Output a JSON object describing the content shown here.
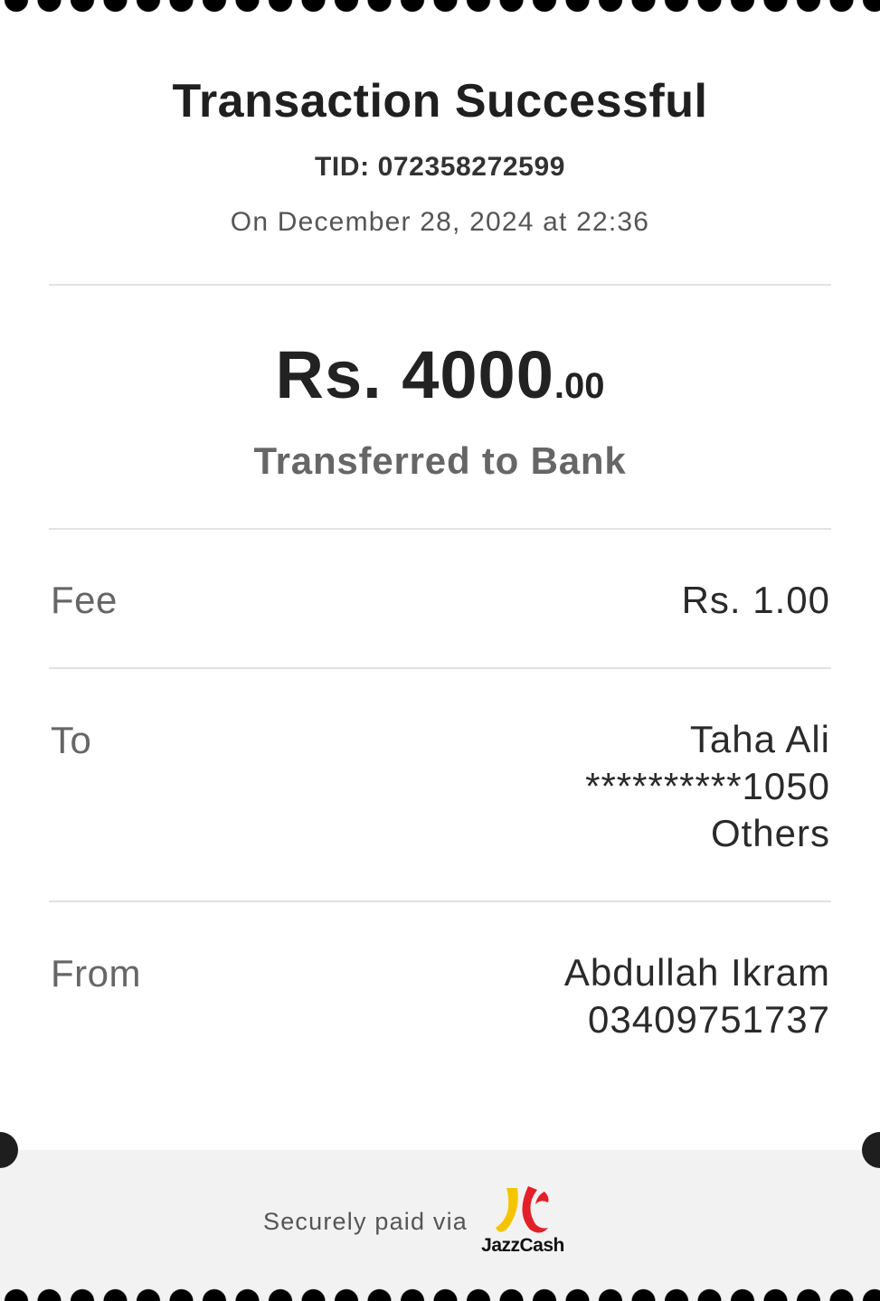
{
  "receipt": {
    "title": "Transaction Successful",
    "tid": "TID: 072358272599",
    "date": "On December 28, 2024 at 22:36",
    "amount_main": "Rs. 4000",
    "amount_cents": ".00",
    "transfer_type": "Transferred to Bank"
  },
  "fee": {
    "label": "Fee",
    "value": "Rs. 1.00"
  },
  "to": {
    "label": "To",
    "name": "Taha Ali",
    "account": "**********1050",
    "bank": "Others"
  },
  "from": {
    "label": "From",
    "name": "Abdullah Ikram",
    "number": "03409751737"
  },
  "footer": {
    "secure_text": "Securely paid via",
    "logo_text": "JazzCash",
    "logo_colors": {
      "yellow": "#f5c400",
      "red": "#e3202a"
    }
  }
}
